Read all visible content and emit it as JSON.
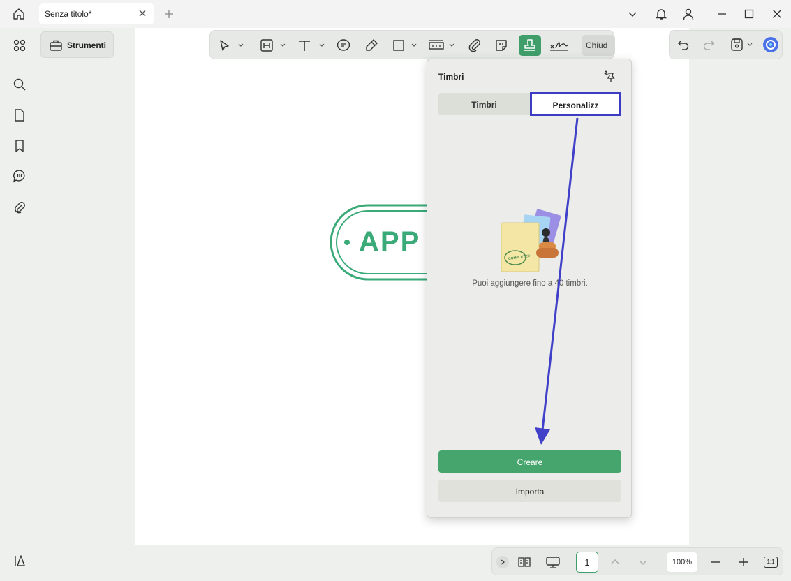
{
  "window": {
    "tab_title": "Senza titolo*"
  },
  "sidebar": {
    "tools_label": "Strumenti"
  },
  "toolbar": {
    "close_label": "Chiud"
  },
  "document": {
    "stamp_text": "APP"
  },
  "stamp_panel": {
    "title": "Timbri",
    "tabs": [
      {
        "label": "Timbri",
        "selected": false
      },
      {
        "label": "Personalizz",
        "selected": true
      }
    ],
    "illustration_stamp_text": "COMPLETED",
    "empty_message": "Puoi aggiungere fino a 40 timbri.",
    "create_label": "Creare",
    "import_label": "Importa"
  },
  "bottom_bar": {
    "page_number": "1",
    "zoom": "100%",
    "fit_label": "1:1"
  },
  "colors": {
    "accent": "#3f9e6a",
    "highlight": "#3d3dc4",
    "stamp_green": "#3aaa78"
  }
}
